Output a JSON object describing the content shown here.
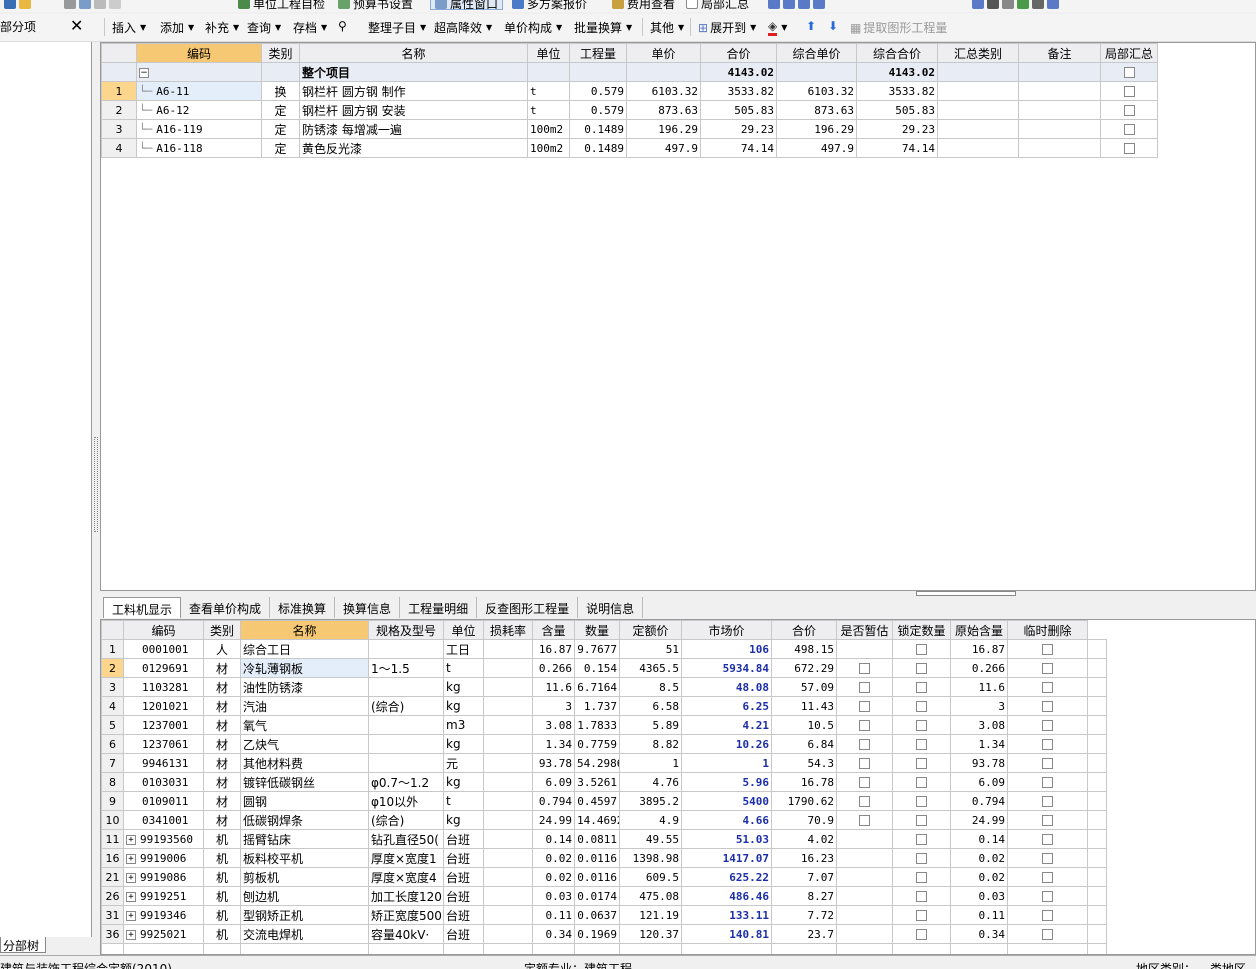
{
  "toolbar_top": {
    "unit_check": "单位工程自检",
    "budget_settings": "预算书设置",
    "property_window": "属性窗口",
    "multi_plan": "多方案报价",
    "fee_view": "费用查看",
    "local_summary": "局部汇总"
  },
  "sidebar": {
    "title": "部分项",
    "tab": "分部树"
  },
  "toolbar": {
    "items": [
      "插入",
      "添加",
      "补充",
      "查询",
      "存档",
      "整理子目",
      "超高降效",
      "单价构成",
      "批量换算",
      "其他",
      "展开到",
      "提取图形工程量"
    ]
  },
  "upper_table": {
    "headers": [
      "编码",
      "类别",
      "名称",
      "单位",
      "工程量",
      "单价",
      "合价",
      "综合单价",
      "综合合价",
      "汇总类别",
      "备注",
      "局部汇总"
    ],
    "total_row": {
      "name": "整个项目",
      "total": "4143.02",
      "comp_total": "4143.02"
    },
    "rows": [
      {
        "no": "1",
        "code": "A6-11",
        "type": "换",
        "name": "钢栏杆 圆方钢 制作",
        "unit": "t",
        "qty": "0.579",
        "price": "6103.32",
        "total": "3533.82",
        "comp_price": "6103.32",
        "comp_total": "3533.82"
      },
      {
        "no": "2",
        "code": "A6-12",
        "type": "定",
        "name": "钢栏杆 圆方钢 安装",
        "unit": "t",
        "qty": "0.579",
        "price": "873.63",
        "total": "505.83",
        "comp_price": "873.63",
        "comp_total": "505.83"
      },
      {
        "no": "3",
        "code": "A16-119",
        "type": "定",
        "name": "防锈漆 每增减一遍",
        "unit": "100m2",
        "qty": "0.1489",
        "price": "196.29",
        "total": "29.23",
        "comp_price": "196.29",
        "comp_total": "29.23"
      },
      {
        "no": "4",
        "code": "A16-118",
        "type": "定",
        "name": "黄色反光漆",
        "unit": "100m2",
        "qty": "0.1489",
        "price": "497.9",
        "total": "74.14",
        "comp_price": "497.9",
        "comp_total": "74.14"
      }
    ]
  },
  "tabs": [
    "工料机显示",
    "查看单价构成",
    "标准换算",
    "换算信息",
    "工程量明细",
    "反查图形工程量",
    "说明信息"
  ],
  "lower_table": {
    "headers": [
      "编码",
      "类别",
      "名称",
      "规格及型号",
      "单位",
      "损耗率",
      "含量",
      "数量",
      "定额价",
      "市场价",
      "合价",
      "是否暂估",
      "锁定数量",
      "原始含量",
      "临时删除"
    ],
    "rows": [
      {
        "no": "1",
        "code": "0001001",
        "type": "人",
        "name": "综合工日",
        "spec": "",
        "unit": "工日",
        "content": "16.87",
        "qty": "9.7677",
        "quota": "51",
        "market": "106",
        "total": "498.15",
        "orig": "16.87",
        "expand": false,
        "est": false
      },
      {
        "no": "2",
        "code": "0129691",
        "type": "材",
        "name": "冷轧薄钢板",
        "spec": "1～1.5",
        "unit": "t",
        "content": "0.266",
        "qty": "0.154",
        "quota": "4365.5",
        "market": "5934.84",
        "total": "672.29",
        "orig": "0.266",
        "expand": false,
        "est": true
      },
      {
        "no": "3",
        "code": "1103281",
        "type": "材",
        "name": "油性防锈漆",
        "spec": "",
        "unit": "kg",
        "content": "11.6",
        "qty": "6.7164",
        "quota": "8.5",
        "market": "48.08",
        "total": "57.09",
        "orig": "11.6",
        "expand": false,
        "est": true
      },
      {
        "no": "4",
        "code": "1201021",
        "type": "材",
        "name": "汽油",
        "spec": "(综合)",
        "unit": "kg",
        "content": "3",
        "qty": "1.737",
        "quota": "6.58",
        "market": "6.25",
        "total": "11.43",
        "orig": "3",
        "expand": false,
        "est": true
      },
      {
        "no": "5",
        "code": "1237001",
        "type": "材",
        "name": "氧气",
        "spec": "",
        "unit": "m3",
        "content": "3.08",
        "qty": "1.7833",
        "quota": "5.89",
        "market": "4.21",
        "total": "10.5",
        "orig": "3.08",
        "expand": false,
        "est": true
      },
      {
        "no": "6",
        "code": "1237061",
        "type": "材",
        "name": "乙炔气",
        "spec": "",
        "unit": "kg",
        "content": "1.34",
        "qty": "0.7759",
        "quota": "8.82",
        "market": "10.26",
        "total": "6.84",
        "orig": "1.34",
        "expand": false,
        "est": true
      },
      {
        "no": "7",
        "code": "9946131",
        "type": "材",
        "name": "其他材料费",
        "spec": "",
        "unit": "元",
        "content": "93.78",
        "qty": "54.2986",
        "quota": "1",
        "market": "1",
        "total": "54.3",
        "orig": "93.78",
        "expand": false,
        "est": true
      },
      {
        "no": "8",
        "code": "0103031",
        "type": "材",
        "name": "镀锌低碳钢丝",
        "spec": "φ0.7～1.2",
        "unit": "kg",
        "content": "6.09",
        "qty": "3.5261",
        "quota": "4.76",
        "market": "5.96",
        "total": "16.78",
        "orig": "6.09",
        "expand": false,
        "est": true
      },
      {
        "no": "9",
        "code": "0109011",
        "type": "材",
        "name": "圆钢",
        "spec": "φ10以外",
        "unit": "t",
        "content": "0.794",
        "qty": "0.4597",
        "quota": "3895.2",
        "market": "5400",
        "total": "1790.62",
        "orig": "0.794",
        "expand": false,
        "est": true
      },
      {
        "no": "10",
        "code": "0341001",
        "type": "材",
        "name": "低碳钢焊条",
        "spec": "(综合)",
        "unit": "kg",
        "content": "24.99",
        "qty": "14.4692",
        "quota": "4.9",
        "market": "4.66",
        "total": "70.9",
        "orig": "24.99",
        "expand": false,
        "est": true
      },
      {
        "no": "11",
        "code": "99193560",
        "type": "机",
        "name": "摇臂钻床",
        "spec": "钻孔直径50(",
        "unit": "台班",
        "content": "0.14",
        "qty": "0.0811",
        "quota": "49.55",
        "market": "51.03",
        "total": "4.02",
        "orig": "0.14",
        "expand": true,
        "est": false
      },
      {
        "no": "16",
        "code": "9919006",
        "type": "机",
        "name": "板料校平机",
        "spec": "厚度×宽度1",
        "unit": "台班",
        "content": "0.02",
        "qty": "0.0116",
        "quota": "1398.98",
        "market": "1417.07",
        "total": "16.23",
        "orig": "0.02",
        "expand": true,
        "est": false
      },
      {
        "no": "21",
        "code": "9919086",
        "type": "机",
        "name": "剪板机",
        "spec": "厚度×宽度4",
        "unit": "台班",
        "content": "0.02",
        "qty": "0.0116",
        "quota": "609.5",
        "market": "625.22",
        "total": "7.07",
        "orig": "0.02",
        "expand": true,
        "est": false
      },
      {
        "no": "26",
        "code": "9919251",
        "type": "机",
        "name": "刨边机",
        "spec": "加工长度120",
        "unit": "台班",
        "content": "0.03",
        "qty": "0.0174",
        "quota": "475.08",
        "market": "486.46",
        "total": "8.27",
        "orig": "0.03",
        "expand": true,
        "est": false
      },
      {
        "no": "31",
        "code": "9919346",
        "type": "机",
        "name": "型钢矫正机",
        "spec": "矫正宽度500",
        "unit": "台班",
        "content": "0.11",
        "qty": "0.0637",
        "quota": "121.19",
        "market": "133.11",
        "total": "7.72",
        "orig": "0.11",
        "expand": true,
        "est": false
      },
      {
        "no": "36",
        "code": "9925021",
        "type": "机",
        "name": "交流电焊机",
        "spec": "容量40kV·",
        "unit": "台班",
        "content": "0.34",
        "qty": "0.1969",
        "quota": "120.37",
        "market": "140.81",
        "total": "23.7",
        "orig": "0.34",
        "expand": true,
        "est": false
      }
    ]
  },
  "status": {
    "left": "建筑与装饰工程综合定额(2010)",
    "mid": "定额专业：建筑工程",
    "right1": "地区类别：",
    "right2": "类地区"
  },
  "colors": {
    "header_highlight": "#f7c873",
    "market_price": "#1c2fa8",
    "total_row": "#e8ecf4"
  }
}
